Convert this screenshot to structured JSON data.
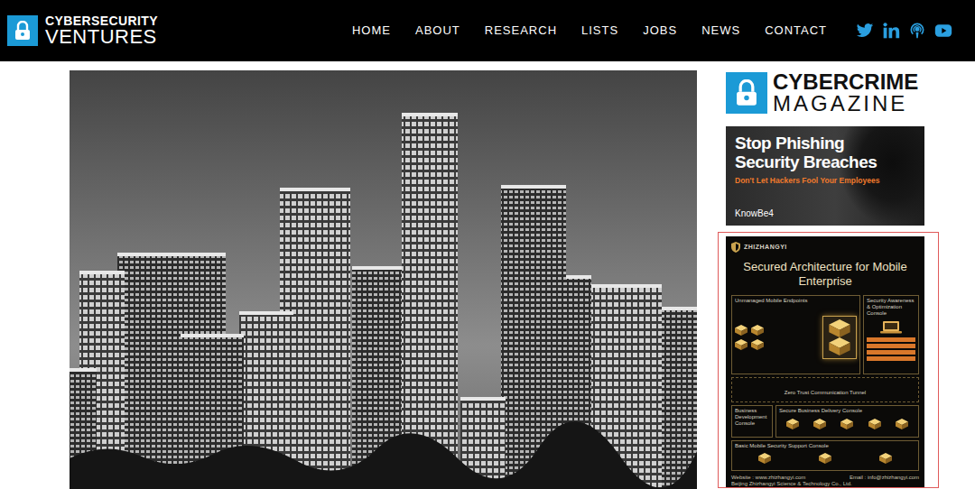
{
  "header": {
    "logo": {
      "line1": "CYBERSECURITY",
      "line2": "VENTURES"
    },
    "nav": [
      {
        "label": "HOME"
      },
      {
        "label": "ABOUT"
      },
      {
        "label": "RESEARCH"
      },
      {
        "label": "LISTS"
      },
      {
        "label": "JOBS"
      },
      {
        "label": "NEWS"
      },
      {
        "label": "CONTACT"
      }
    ],
    "social": [
      {
        "kind": "twitter"
      },
      {
        "kind": "linkedin"
      },
      {
        "kind": "podcast"
      },
      {
        "kind": "youtube"
      }
    ]
  },
  "sidebar": {
    "magazine": {
      "line1": "CYBERCRIME",
      "line2": "MAGAZINE"
    },
    "ads": [
      {
        "kind": "phishing",
        "highlighted": false,
        "title": [
          "Stop Phishing",
          "Security Breaches"
        ],
        "tagline": "Don't Let Hackers Fool Your Employees",
        "brand": "KnowBe4"
      },
      {
        "kind": "architecture",
        "highlighted": true,
        "brand": "ZHIZHANGYI",
        "title": "Secured Architecture for Mobile Enterprise",
        "diagram": {
          "endpoints": "Unmanaged Mobile Endpoints",
          "awareness": "Security Awareness & Optimization Console",
          "tunnel": "Zero Trust Communication Tunnel",
          "development": "Business Development Console",
          "delivery": "Secure Business Delivery Console",
          "support": "Basic Mobile Security Support Console"
        },
        "footer": {
          "website": "Website : www.zhizhangyi.com",
          "email": "Email : info@zhizhangyi.com",
          "company": "Beijing Zhizhangyi Science & Technology Co., Ltd."
        }
      }
    ]
  }
}
